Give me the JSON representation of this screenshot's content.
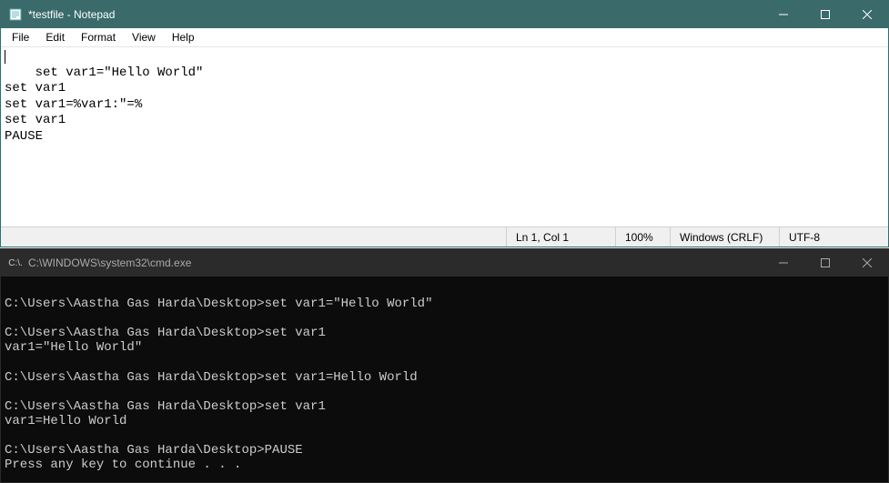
{
  "notepad": {
    "title": "*testfile - Notepad",
    "menu": {
      "file": "File",
      "edit": "Edit",
      "format": "Format",
      "view": "View",
      "help": "Help"
    },
    "content": "set var1=\"Hello World\"\nset var1\nset var1=%var1:\"=%\nset var1\nPAUSE",
    "status": {
      "position": "Ln 1, Col 1",
      "zoom": "100%",
      "lineEnding": "Windows (CRLF)",
      "encoding": "UTF-8"
    }
  },
  "cmd": {
    "title": "C:\\WINDOWS\\system32\\cmd.exe",
    "iconText": "C:\\.",
    "output": "\nC:\\Users\\Aastha Gas Harda\\Desktop>set var1=\"Hello World\"\n\nC:\\Users\\Aastha Gas Harda\\Desktop>set var1\nvar1=\"Hello World\"\n\nC:\\Users\\Aastha Gas Harda\\Desktop>set var1=Hello World\n\nC:\\Users\\Aastha Gas Harda\\Desktop>set var1\nvar1=Hello World\n\nC:\\Users\\Aastha Gas Harda\\Desktop>PAUSE\nPress any key to continue . . ."
  }
}
